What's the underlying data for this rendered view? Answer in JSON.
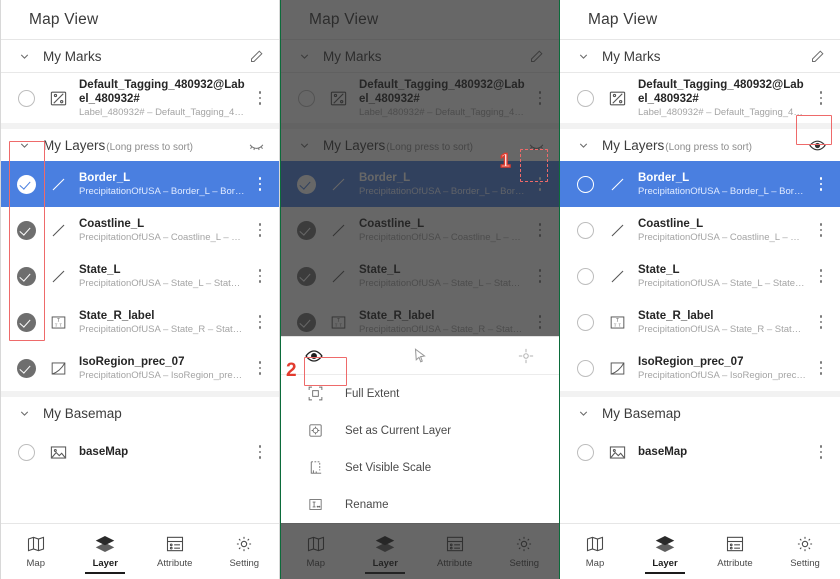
{
  "app": {
    "title": "Map View"
  },
  "groups": {
    "marks": {
      "label": "My Marks",
      "hint": "",
      "action_icon": "pencil-icon"
    },
    "layers": {
      "label": "My Layers",
      "hint": "(Long press to sort)",
      "action_icon_hidden": "eye-off-icon",
      "action_icon_visible": "eye-icon"
    },
    "basemap": {
      "label": "My Basemap",
      "hint": ""
    }
  },
  "marks": [
    {
      "title": "Default_Tagging_480932@Label_480932#",
      "subtitle": "Label_480932# – Default_Tagging_4809...",
      "icon": "label-polygon-icon",
      "checked": false
    }
  ],
  "layers": [
    {
      "title": "Border_L",
      "subtitle": "PrecipitationOfUSA – Border_L – Border...",
      "icon": "line-icon",
      "selected": true
    },
    {
      "title": "Coastline_L",
      "subtitle": "PrecipitationOfUSA – Coastline_L – Coa...",
      "icon": "line-icon",
      "selected": false
    },
    {
      "title": "State_L",
      "subtitle": "PrecipitationOfUSA – State_L – State_L...",
      "icon": "line-icon",
      "selected": false
    },
    {
      "title": "State_R_label",
      "subtitle": "PrecipitationOfUSA – State_R – State_R...",
      "icon": "text-label-icon",
      "selected": false
    },
    {
      "title": "IsoRegion_prec_07",
      "subtitle": "PrecipitationOfUSA – IsoRegion_prec_0...",
      "icon": "region-icon",
      "selected": false
    }
  ],
  "basemap": [
    {
      "title": "baseMap",
      "subtitle": "",
      "icon": "image-icon",
      "checked": false
    }
  ],
  "context_menu": {
    "top_buttons": [
      {
        "name": "eye-icon",
        "label": ""
      },
      {
        "name": "cursor-icon",
        "label": ""
      },
      {
        "name": "crosshair-icon",
        "label": ""
      }
    ],
    "items": [
      {
        "label": "Full Extent",
        "icon": "full-extent-icon"
      },
      {
        "label": "Set as Current Layer",
        "icon": "current-layer-icon"
      },
      {
        "label": "Set Visible Scale",
        "icon": "visible-scale-icon"
      },
      {
        "label": "Rename",
        "icon": "rename-icon"
      }
    ]
  },
  "bottom_nav": [
    {
      "label": "Map",
      "icon": "map-icon",
      "active": false
    },
    {
      "label": "Layer",
      "icon": "layers-icon",
      "active": true
    },
    {
      "label": "Attribute",
      "icon": "attribute-icon",
      "active": false
    },
    {
      "label": "Setting",
      "icon": "gear-icon",
      "active": false
    }
  ],
  "annotations": {
    "step1": "1",
    "step2": "2",
    "highlight_color": "#ee6a6a"
  },
  "colors": {
    "accent_blue": "#4a7fe0",
    "check_gray": "#6e6e6e",
    "annotation_red": "#e23b2e"
  }
}
